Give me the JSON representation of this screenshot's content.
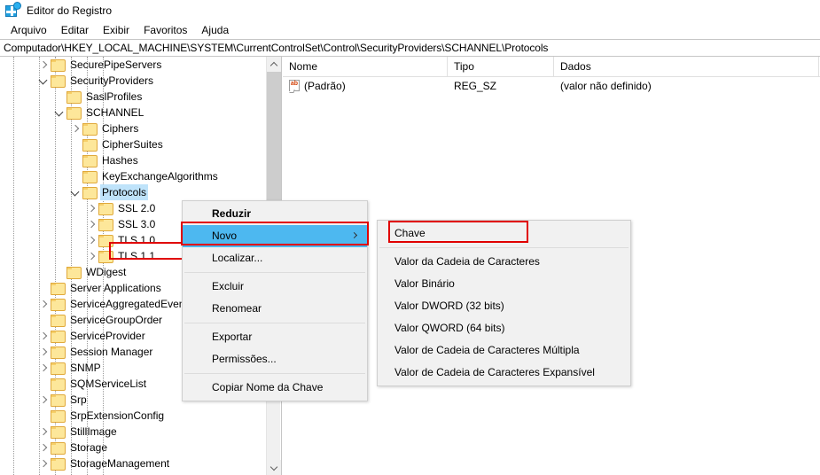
{
  "window": {
    "title": "Editor do Registro",
    "icon": "registry-editor-icon"
  },
  "menubar": {
    "items": [
      {
        "label": "Arquivo"
      },
      {
        "label": "Editar"
      },
      {
        "label": "Exibir"
      },
      {
        "label": "Favoritos"
      },
      {
        "label": "Ajuda"
      }
    ]
  },
  "address": {
    "path": "Computador\\HKEY_LOCAL_MACHINE\\SYSTEM\\CurrentControlSet\\Control\\SecurityProviders\\SCHANNEL\\Protocols"
  },
  "tree": {
    "items": [
      {
        "label": "SecurePipeServers",
        "depth": 4,
        "twist": "collapsed",
        "selected": false
      },
      {
        "label": "SecurityProviders",
        "depth": 4,
        "twist": "expanded",
        "selected": false
      },
      {
        "label": "SaslProfiles",
        "depth": 5,
        "twist": "none",
        "selected": false
      },
      {
        "label": "SCHANNEL",
        "depth": 5,
        "twist": "expanded",
        "selected": false
      },
      {
        "label": "Ciphers",
        "depth": 6,
        "twist": "collapsed",
        "selected": false
      },
      {
        "label": "CipherSuites",
        "depth": 6,
        "twist": "none",
        "selected": false
      },
      {
        "label": "Hashes",
        "depth": 6,
        "twist": "none",
        "selected": false
      },
      {
        "label": "KeyExchangeAlgorithms",
        "depth": 6,
        "twist": "none",
        "selected": false
      },
      {
        "label": "Protocols",
        "depth": 6,
        "twist": "expanded",
        "selected": true
      },
      {
        "label": "SSL 2.0",
        "depth": 7,
        "twist": "collapsed",
        "selected": false
      },
      {
        "label": "SSL 3.0",
        "depth": 7,
        "twist": "collapsed",
        "selected": false
      },
      {
        "label": "TLS 1.0",
        "depth": 7,
        "twist": "collapsed",
        "selected": false
      },
      {
        "label": "TLS 1.1",
        "depth": 7,
        "twist": "collapsed",
        "selected": false
      },
      {
        "label": "WDigest",
        "depth": 5,
        "twist": "none",
        "selected": false
      },
      {
        "label": "Server Applications",
        "depth": 4,
        "twist": "none",
        "selected": false
      },
      {
        "label": "ServiceAggregatedEvents",
        "depth": 4,
        "twist": "collapsed",
        "selected": false
      },
      {
        "label": "ServiceGroupOrder",
        "depth": 4,
        "twist": "none",
        "selected": false
      },
      {
        "label": "ServiceProvider",
        "depth": 4,
        "twist": "collapsed",
        "selected": false
      },
      {
        "label": "Session Manager",
        "depth": 4,
        "twist": "collapsed",
        "selected": false
      },
      {
        "label": "SNMP",
        "depth": 4,
        "twist": "collapsed",
        "selected": false
      },
      {
        "label": "SQMServiceList",
        "depth": 4,
        "twist": "none",
        "selected": false
      },
      {
        "label": "Srp",
        "depth": 4,
        "twist": "collapsed",
        "selected": false
      },
      {
        "label": "SrpExtensionConfig",
        "depth": 4,
        "twist": "none",
        "selected": false
      },
      {
        "label": "StillImage",
        "depth": 4,
        "twist": "collapsed",
        "selected": false
      },
      {
        "label": "Storage",
        "depth": 4,
        "twist": "collapsed",
        "selected": false
      },
      {
        "label": "StorageManagement",
        "depth": 4,
        "twist": "collapsed",
        "selected": false
      }
    ]
  },
  "list": {
    "columns": [
      {
        "label": "Nome"
      },
      {
        "label": "Tipo"
      },
      {
        "label": "Dados"
      }
    ],
    "rows": [
      {
        "icon": "string-value-icon",
        "name": "(Padrão)",
        "type": "REG_SZ",
        "data": "(valor não definido)"
      }
    ]
  },
  "context_menu": {
    "items": [
      {
        "label": "Reduzir",
        "bold": true,
        "highlighted": false,
        "submenu": false,
        "sep_after": false
      },
      {
        "label": "Novo",
        "bold": false,
        "highlighted": true,
        "submenu": true,
        "sep_after": false
      },
      {
        "label": "Localizar...",
        "bold": false,
        "highlighted": false,
        "submenu": false,
        "sep_after": true
      },
      {
        "label": "Excluir",
        "bold": false,
        "highlighted": false,
        "submenu": false,
        "sep_after": false
      },
      {
        "label": "Renomear",
        "bold": false,
        "highlighted": false,
        "submenu": false,
        "sep_after": true
      },
      {
        "label": "Exportar",
        "bold": false,
        "highlighted": false,
        "submenu": false,
        "sep_after": false
      },
      {
        "label": "Permissões...",
        "bold": false,
        "highlighted": false,
        "submenu": false,
        "sep_after": true
      },
      {
        "label": "Copiar Nome da Chave",
        "bold": false,
        "highlighted": false,
        "submenu": false,
        "sep_after": false
      }
    ]
  },
  "submenu": {
    "items": [
      {
        "label": "Chave",
        "sep_after": true
      },
      {
        "label": "Valor da Cadeia de Caracteres",
        "sep_after": false
      },
      {
        "label": "Valor Binário",
        "sep_after": false
      },
      {
        "label": "Valor DWORD (32 bits)",
        "sep_after": false
      },
      {
        "label": "Valor QWORD (64 bits)",
        "sep_after": false
      },
      {
        "label": "Valor de Cadeia de Caracteres Múltipla",
        "sep_after": false
      },
      {
        "label": "Valor de Cadeia de Caracteres Expansível",
        "sep_after": false
      }
    ]
  },
  "annotations": {
    "color": "#e00000",
    "targets": [
      "Protocols",
      "Novo",
      "Chave"
    ]
  },
  "colors": {
    "selection": "#bfe3fa",
    "menu_highlight": "#4db8f0",
    "folder": "#fde79a",
    "annotation": "#e00000"
  }
}
